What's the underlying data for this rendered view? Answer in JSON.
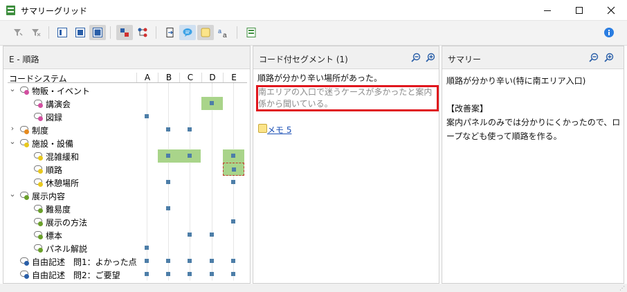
{
  "window": {
    "title": "サマリーグリッド"
  },
  "panels": {
    "matrix": {
      "title": "E - 順路",
      "header": "コードシステム",
      "columns": [
        "A",
        "B",
        "C",
        "D",
        "E"
      ],
      "rows": [
        {
          "label": "物販・イベント",
          "level": 0,
          "expander": "v",
          "color": "#d24fa0",
          "cells": [
            0,
            0,
            0,
            0,
            0
          ]
        },
        {
          "label": "講演会",
          "level": 1,
          "expander": "",
          "color": "#d24fa0",
          "cells": [
            0,
            0,
            0,
            2,
            0
          ]
        },
        {
          "label": "図録",
          "level": 1,
          "expander": "",
          "color": "#d24fa0",
          "cells": [
            1,
            0,
            0,
            0,
            0
          ]
        },
        {
          "label": "制度",
          "level": 0,
          "expander": ">",
          "color": "#e58a1f",
          "cells": [
            0,
            1,
            1,
            0,
            0
          ]
        },
        {
          "label": "施設・設備",
          "level": 0,
          "expander": "v",
          "color": "#e8c81e",
          "cells": [
            0,
            0,
            0,
            0,
            0
          ]
        },
        {
          "label": "混雑緩和",
          "level": 1,
          "expander": "",
          "color": "#e8c81e",
          "cells": [
            0,
            2,
            2,
            0,
            2
          ]
        },
        {
          "label": "順路",
          "level": 1,
          "expander": "",
          "color": "#e8c81e",
          "cells": [
            0,
            0,
            0,
            0,
            3
          ]
        },
        {
          "label": "休憩場所",
          "level": 1,
          "expander": "",
          "color": "#e8c81e",
          "cells": [
            0,
            1,
            0,
            0,
            1
          ]
        },
        {
          "label": "展示内容",
          "level": 0,
          "expander": "v",
          "color": "#6aa02a",
          "cells": [
            0,
            0,
            0,
            0,
            0
          ]
        },
        {
          "label": "難易度",
          "level": 1,
          "expander": "",
          "color": "#6aa02a",
          "cells": [
            0,
            1,
            0,
            0,
            0
          ]
        },
        {
          "label": "展示の方法",
          "level": 1,
          "expander": "",
          "color": "#6aa02a",
          "cells": [
            0,
            0,
            0,
            0,
            1
          ]
        },
        {
          "label": "標本",
          "level": 1,
          "expander": "",
          "color": "#6aa02a",
          "cells": [
            0,
            0,
            1,
            1,
            0
          ]
        },
        {
          "label": "パネル解説",
          "level": 1,
          "expander": "",
          "color": "#6aa02a",
          "cells": [
            1,
            0,
            0,
            0,
            0
          ]
        },
        {
          "label": "自由記述　問1：よかった点",
          "level": 0,
          "expander": "",
          "color": "#2a5fa8",
          "cells": [
            1,
            1,
            1,
            1,
            1
          ]
        },
        {
          "label": "自由記述　問2：ご要望",
          "level": 0,
          "expander": "",
          "color": "#2a5fa8",
          "cells": [
            1,
            1,
            1,
            1,
            1
          ]
        }
      ]
    },
    "segments": {
      "title": "コード付セグメント (1)",
      "line1": "順路が分かり辛い場所があった。",
      "highlight": "南エリアの入口で迷うケースが多かったと案内係から聞いている。",
      "memo": "メモ 5"
    },
    "summary": {
      "title": "サマリー",
      "text": "順路が分かり辛い(特に南エリア入口)\n\n【改善案】\n案内パネルのみでは分かりにくかったので、ロープなども使って順路を作る。"
    }
  },
  "icons": {
    "toolbar": [
      "filter-icon",
      "filter-clear-icon",
      "layout-left-icon",
      "layout-center-icon",
      "layout-full-icon",
      "code-relations-icon",
      "code-branch-icon",
      "export-icon",
      "comment-icon",
      "memo-icon",
      "font-size-icon",
      "summary-table-icon",
      "info-icon"
    ]
  },
  "colors": {
    "accent": "#2a7de1",
    "highlight_border": "#e0161d",
    "cell_highlight": "#a9d48a",
    "square": "#4d7ea8"
  }
}
